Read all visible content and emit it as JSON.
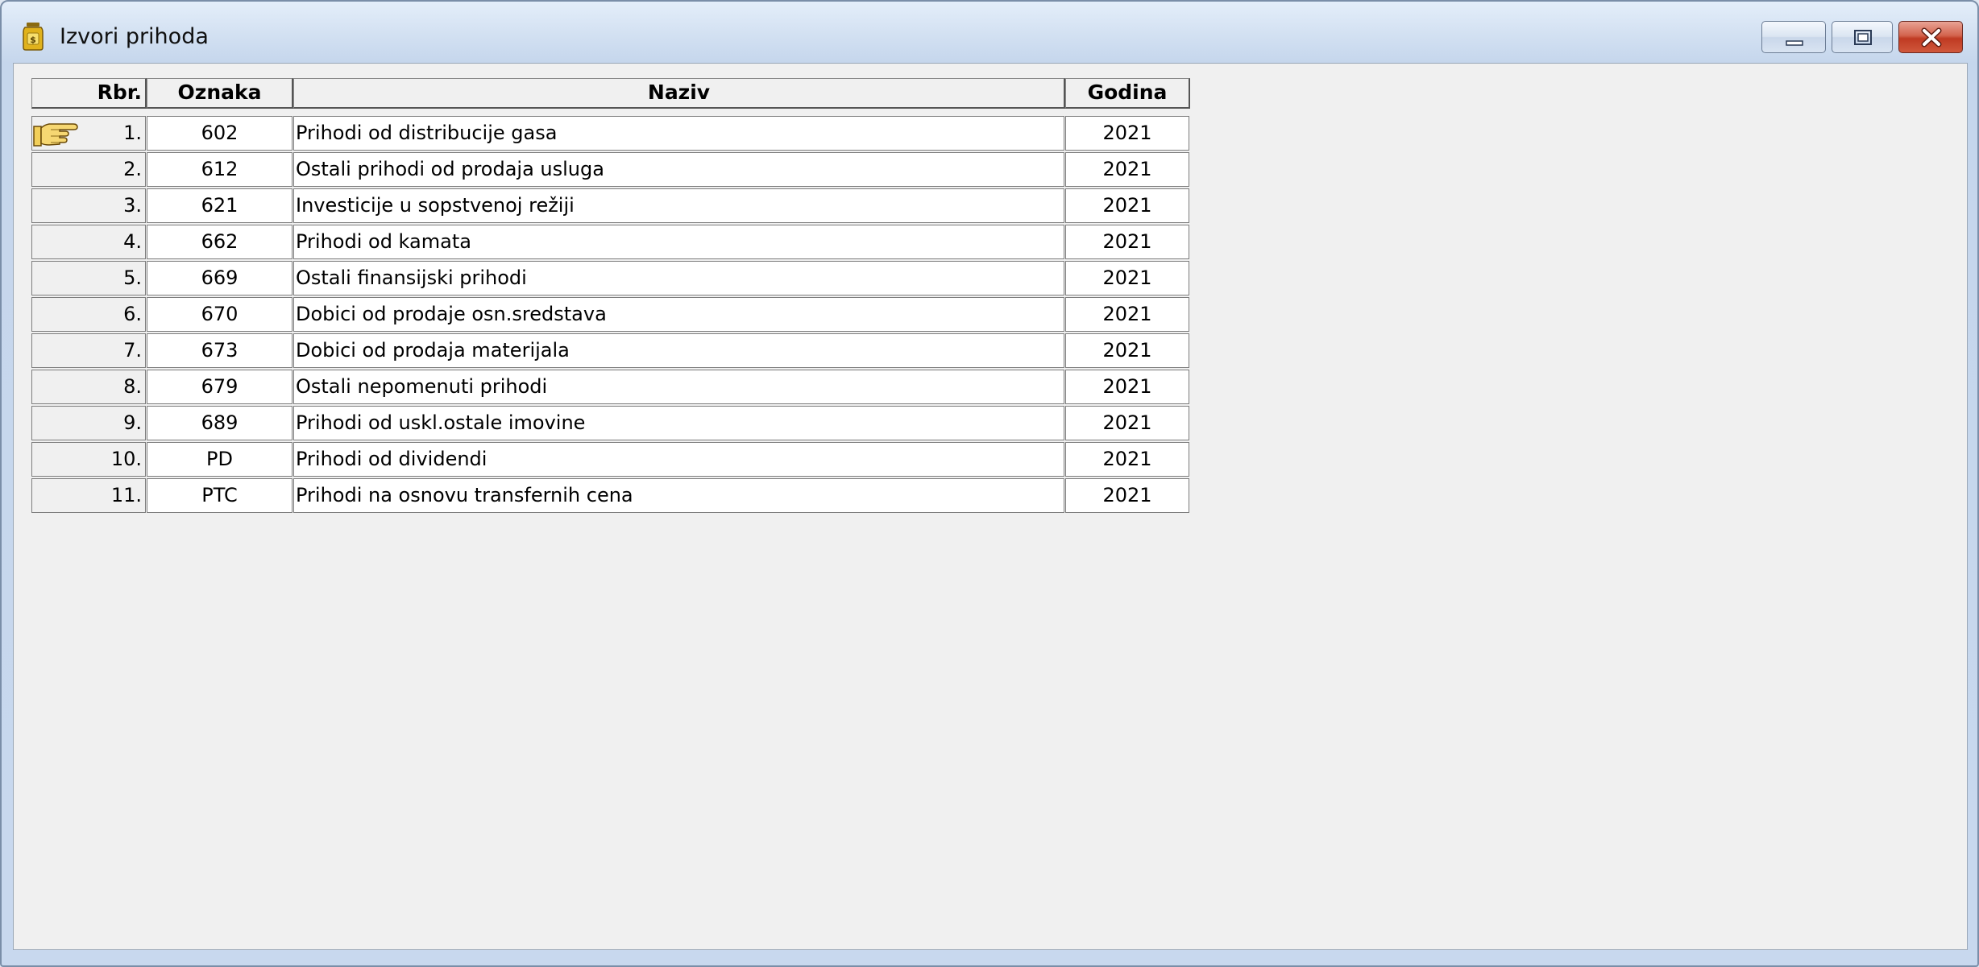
{
  "window": {
    "title": "Izvori prihoda"
  },
  "icons": {
    "app": "money-jar-icon",
    "minimize": "minimize-icon",
    "maximize": "maximize-icon",
    "close": "close-icon",
    "row_pointer": "pointing-hand-icon"
  },
  "table": {
    "headers": {
      "rbr": "Rbr.",
      "oznaka": "Oznaka",
      "naziv": "Naziv",
      "godina": "Godina"
    },
    "rows": [
      {
        "rbr": "1.",
        "oznaka": "602",
        "naziv": "Prihodi od distribucije gasa",
        "godina": "2021"
      },
      {
        "rbr": "2.",
        "oznaka": "612",
        "naziv": "Ostali prihodi od prodaja usluga",
        "godina": "2021"
      },
      {
        "rbr": "3.",
        "oznaka": "621",
        "naziv": "Investicije u sopstvenoj režiji",
        "godina": "2021"
      },
      {
        "rbr": "4.",
        "oznaka": "662",
        "naziv": "Prihodi od kamata",
        "godina": "2021"
      },
      {
        "rbr": "5.",
        "oznaka": "669",
        "naziv": "Ostali finansijski prihodi",
        "godina": "2021"
      },
      {
        "rbr": "6.",
        "oznaka": "670",
        "naziv": "Dobici od prodaje osn.sredstava",
        "godina": "2021"
      },
      {
        "rbr": "7.",
        "oznaka": "673",
        "naziv": "Dobici od prodaja materijala",
        "godina": "2021"
      },
      {
        "rbr": "8.",
        "oznaka": "679",
        "naziv": "Ostali nepomenuti prihodi",
        "godina": "2021"
      },
      {
        "rbr": "9.",
        "oznaka": "689",
        "naziv": "Prihodi od uskl.ostale imovine",
        "godina": "2021"
      },
      {
        "rbr": "10.",
        "oznaka": "PD",
        "naziv": "Prihodi od dividendi",
        "godina": "2021"
      },
      {
        "rbr": "11.",
        "oznaka": "PTC",
        "naziv": "Prihodi na osnovu transfernih cena",
        "godina": "2021"
      }
    ]
  }
}
